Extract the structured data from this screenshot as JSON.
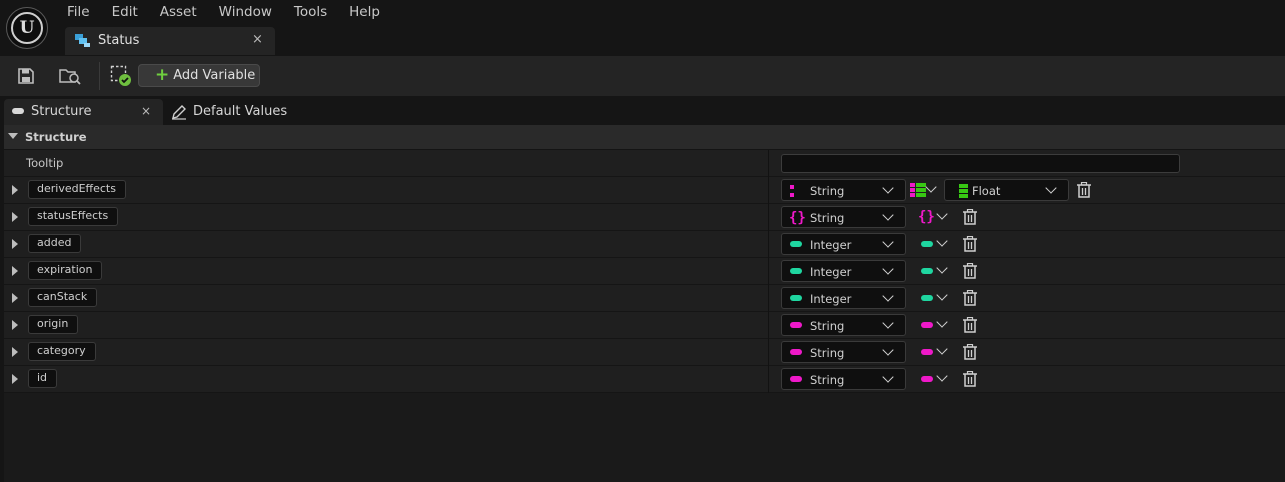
{
  "menu": [
    "File",
    "Edit",
    "Asset",
    "Window",
    "Tools",
    "Help"
  ],
  "document_tab": {
    "title": "Status",
    "close": "×"
  },
  "toolbar": {
    "add_variable_label": "Add Variable"
  },
  "panel_tabs": {
    "structure": "Structure",
    "structure_close": "×",
    "default_values": "Default Values"
  },
  "category": {
    "title": "Structure"
  },
  "tooltip": {
    "label": "Tooltip",
    "value": ""
  },
  "colors": {
    "string": "#ef19c9",
    "integer": "#1fd6a0",
    "float": "#38c814",
    "map": "#1fc81f"
  },
  "variables": [
    {
      "name": "derivedEffects",
      "type": "String",
      "container": "map",
      "value_type": "Float"
    },
    {
      "name": "statusEffects",
      "type": "String",
      "container": "set"
    },
    {
      "name": "added",
      "type": "Integer",
      "container": "single"
    },
    {
      "name": "expiration",
      "type": "Integer",
      "container": "single"
    },
    {
      "name": "canStack",
      "type": "Integer",
      "container": "single"
    },
    {
      "name": "origin",
      "type": "String",
      "container": "single"
    },
    {
      "name": "category",
      "type": "String",
      "container": "single"
    },
    {
      "name": "id",
      "type": "String",
      "container": "single"
    }
  ]
}
